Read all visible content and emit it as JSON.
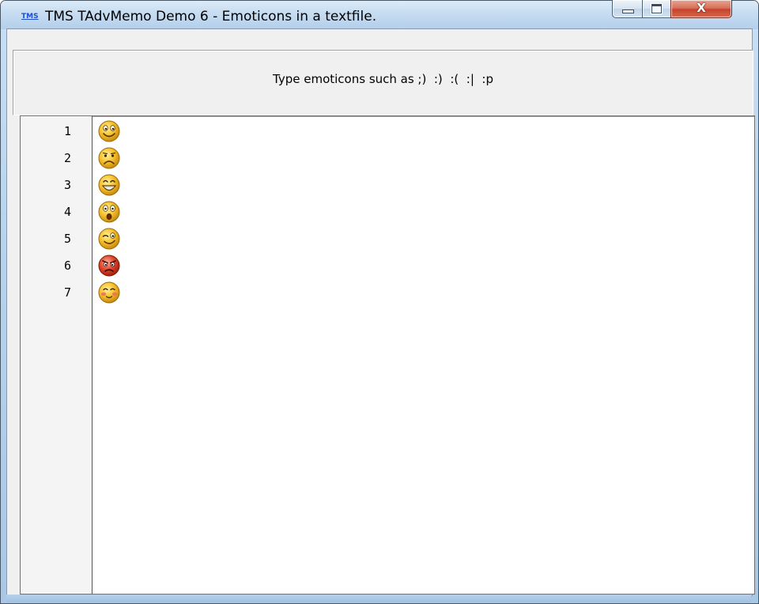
{
  "window": {
    "app_icon_text": "TMS",
    "title": "TMS TAdvMemo Demo 6 - Emoticons in a textfile.",
    "close_glyph": "X",
    "caption_buttons": [
      "minimize",
      "maximize",
      "close"
    ]
  },
  "panel": {
    "hint": "Type emoticons such as ;)  :)  :(  :|  :p"
  },
  "memo": {
    "lines": [
      {
        "number": "1",
        "emoticon": "smile-emoticon"
      },
      {
        "number": "2",
        "emoticon": "sad-emoticon"
      },
      {
        "number": "3",
        "emoticon": "big-grin-emoticon"
      },
      {
        "number": "4",
        "emoticon": "surprised-emoticon"
      },
      {
        "number": "5",
        "emoticon": "wink-emoticon"
      },
      {
        "number": "6",
        "emoticon": "angry-emoticon"
      },
      {
        "number": "7",
        "emoticon": "blush-emoticon"
      }
    ]
  },
  "colors": {
    "titlebar": "#c6dcf1",
    "close_button": "#c7432b",
    "panel": "#f0f0f0",
    "memo_bg": "#ffffff",
    "emoticon_yellow": "#f6c02a",
    "emoticon_red": "#e0452a"
  }
}
